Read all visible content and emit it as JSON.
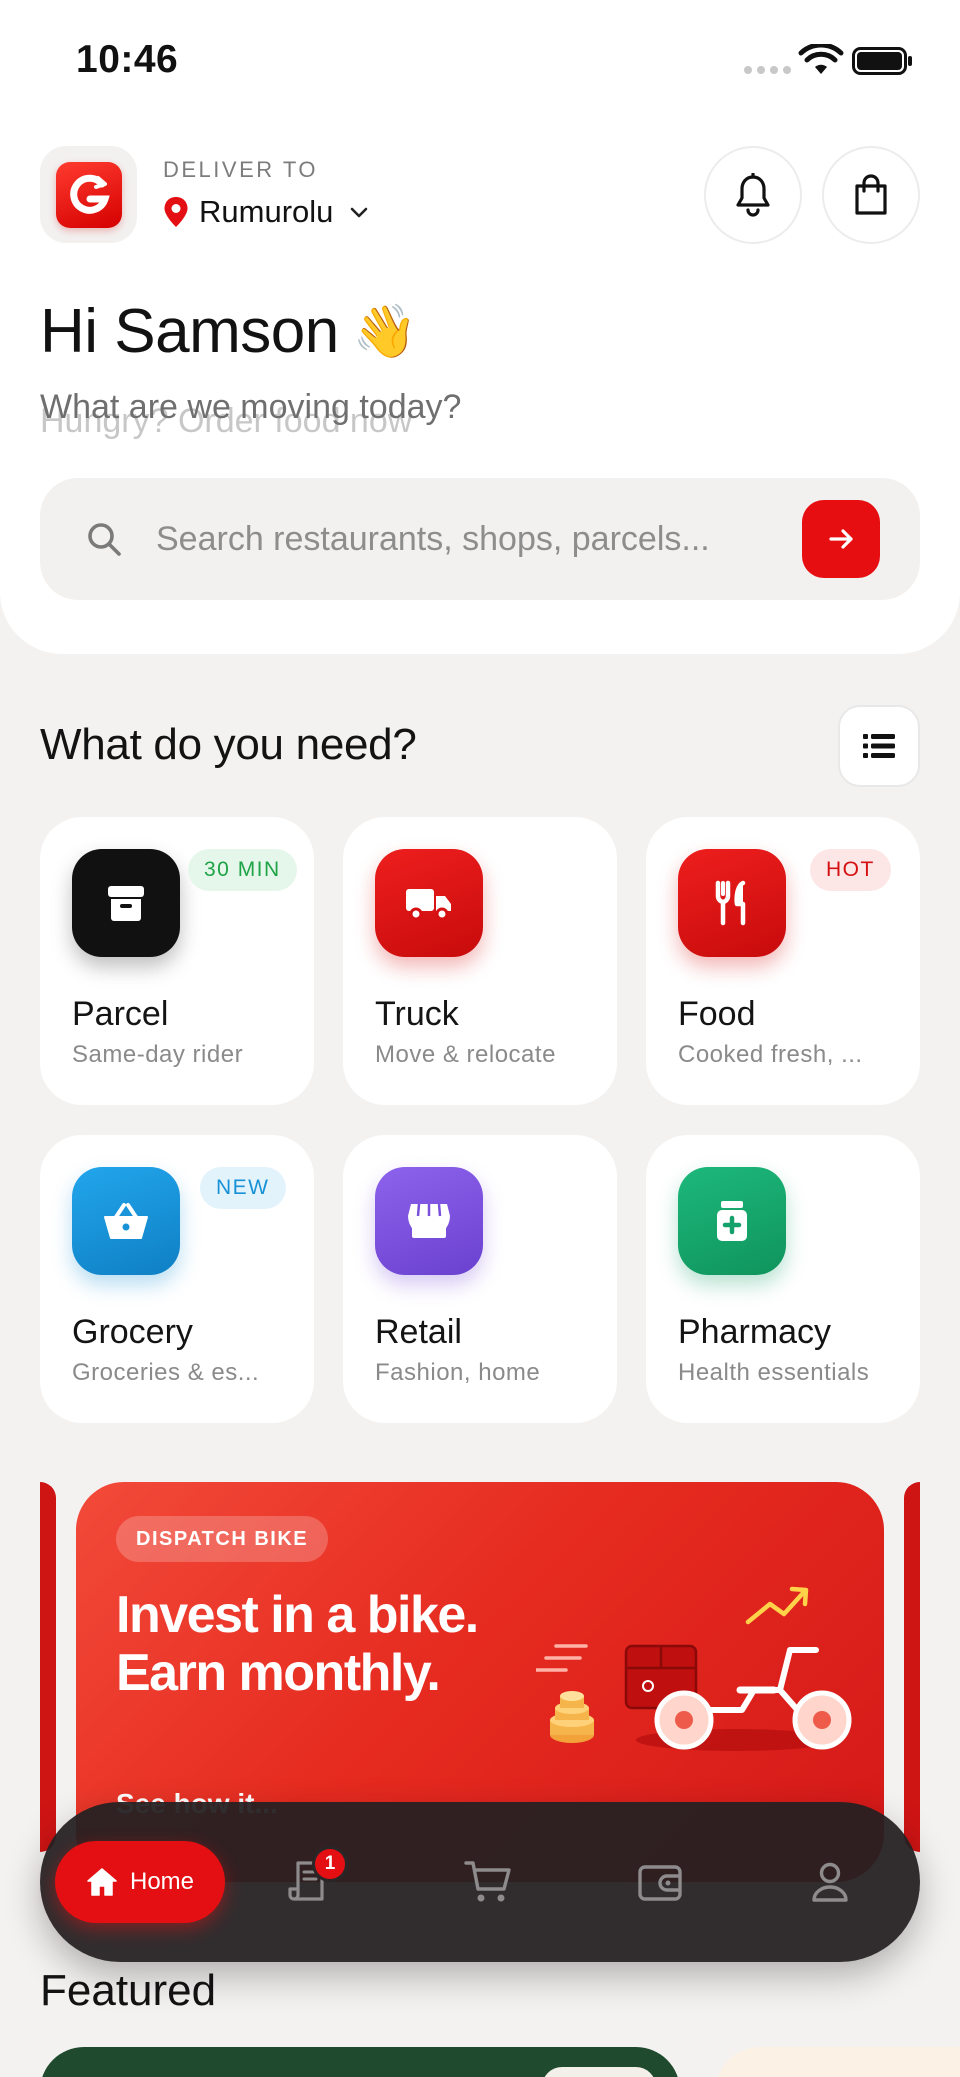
{
  "status_bar": {
    "time": "10:46"
  },
  "header": {
    "deliver_label": "DELIVER TO",
    "location": "Rumurolu"
  },
  "greeting": {
    "title": "Hi Samson",
    "emoji": "👋",
    "subtitle": "What are we moving today?",
    "subtitle_next": "Hungry? Order food now"
  },
  "search": {
    "placeholder": "Search restaurants, shops, parcels..."
  },
  "services": {
    "title": "What do you need?",
    "items": [
      {
        "name": "Parcel",
        "desc": "Same-day rider",
        "badge": "30 MIN",
        "icon": "box-icon",
        "color": "#111111"
      },
      {
        "name": "Truck",
        "desc": "Move & relocate",
        "badge": "",
        "icon": "truck-icon",
        "color": "#d61010"
      },
      {
        "name": "Food",
        "desc": "Cooked fresh, ...",
        "badge": "HOT",
        "icon": "fork-knife-icon",
        "color": "#d61010"
      },
      {
        "name": "Grocery",
        "desc": "Groceries & es...",
        "badge": "NEW",
        "icon": "basket-icon",
        "color": "#1892d6"
      },
      {
        "name": "Retail",
        "desc": "Fashion, home",
        "badge": "",
        "icon": "store-icon",
        "color": "#7a4fdc"
      },
      {
        "name": "Pharmacy",
        "desc": "Health essentials",
        "badge": "",
        "icon": "medicine-icon",
        "color": "#14a06a"
      }
    ]
  },
  "promo": {
    "tag": "DISPATCH BIKE",
    "title_line1": "Invest in a bike.",
    "title_line2": "Earn monthly.",
    "cta": "See how it..."
  },
  "featured": {
    "title": "Featured"
  },
  "bottom_nav": {
    "home": "Home",
    "orders_badge": "1",
    "items": [
      "orders-icon",
      "cart-icon",
      "wallet-icon",
      "profile-icon"
    ]
  },
  "colors": {
    "accent": "#e30f12",
    "background": "#f4f2f1",
    "nav_bg": "#242022"
  }
}
